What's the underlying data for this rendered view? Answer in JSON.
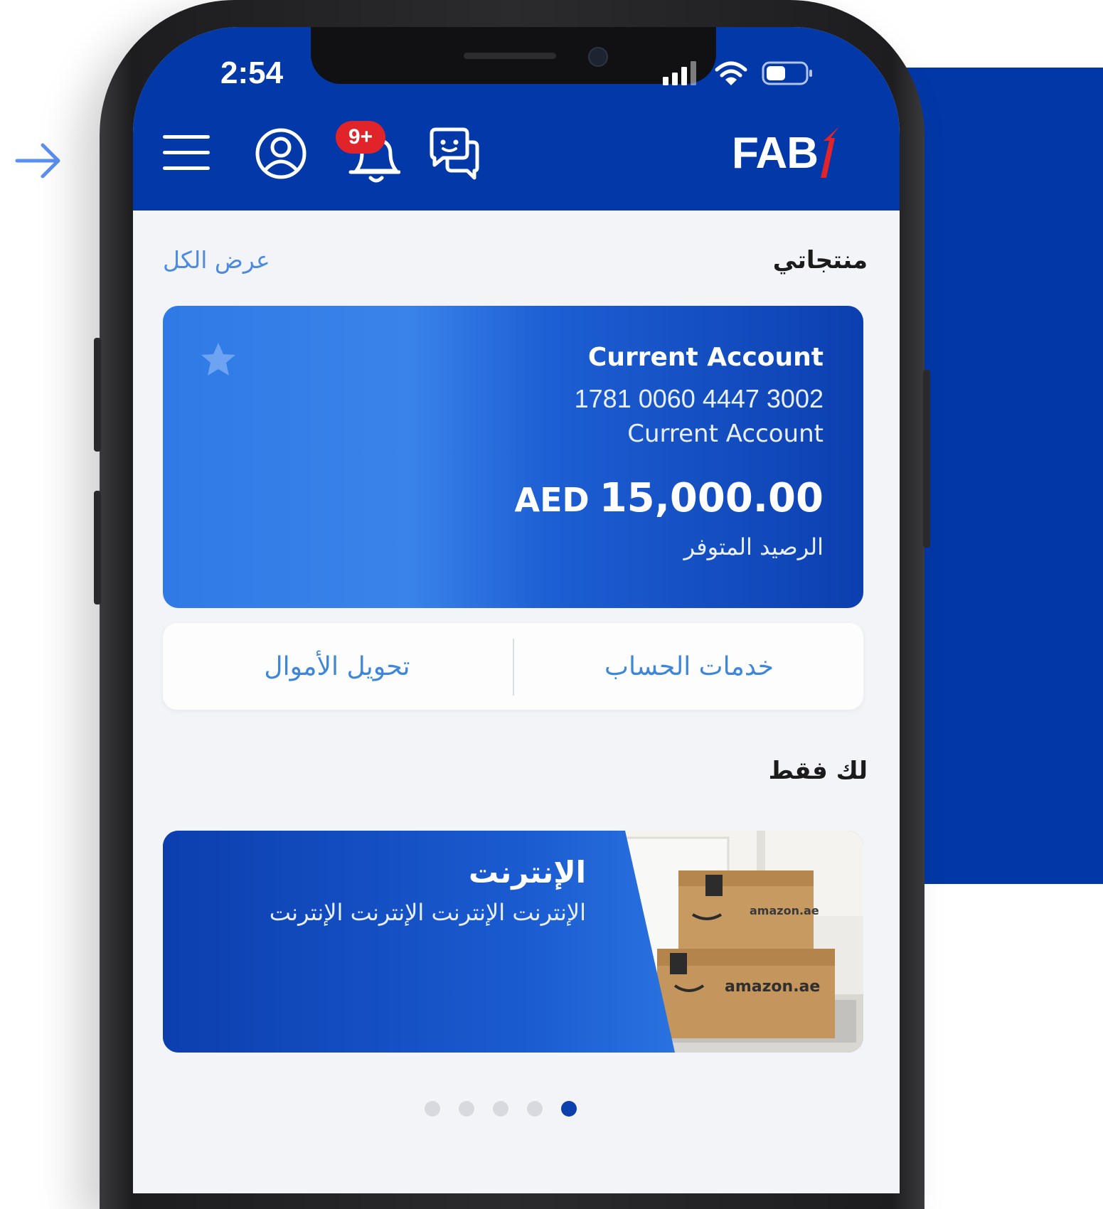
{
  "status_bar": {
    "time": "2:54"
  },
  "header": {
    "notification_badge": "9+",
    "logo_text": "FAB",
    "logo_mark_color": "#e1232a"
  },
  "products": {
    "title": "منتجاتي",
    "view_all": "عرض الكل"
  },
  "account_card": {
    "name": "Current Account",
    "number": "1781 0060 4447 3002",
    "type": "Current Account",
    "currency": "AED",
    "balance": "15,000.00",
    "balance_label": "الرصيد المتوفر"
  },
  "actions": {
    "account_services": "خدمات الحساب",
    "transfer_money": "تحويل الأموال"
  },
  "for_you": {
    "title": "لك فقط"
  },
  "promo": {
    "title": "الإنترنت",
    "text": "الإنترنت الإنترنت الإنترنت الإنترنت",
    "box_label_top": "amazon.ae",
    "box_label_bottom": "amazon.ae"
  },
  "carousel": {
    "count": 5,
    "active_index": 4
  },
  "colors": {
    "brand_blue": "#0238a7",
    "card_blue": "#2f7ae6",
    "link_blue": "#4c8be0",
    "badge_red": "#e1232a"
  }
}
